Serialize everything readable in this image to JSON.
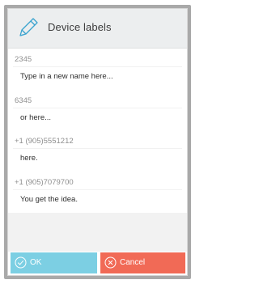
{
  "dialog": {
    "title": "Device labels",
    "title_icon": "pencil-icon"
  },
  "entries": [
    {
      "number": "2345",
      "label": "Type in a new name here..."
    },
    {
      "number": "6345",
      "label": "or here..."
    },
    {
      "number": "+1 (905)5551212",
      "label": "here."
    },
    {
      "number": "+1 (905)7079700",
      "label": "You get the idea."
    }
  ],
  "buttons": {
    "ok_label": "OK",
    "ok_icon": "check-circle-icon",
    "cancel_label": "Cancel",
    "cancel_icon": "x-circle-icon"
  },
  "colors": {
    "ok": "#7ccfe3",
    "cancel": "#f16a56",
    "header_bg": "#eceeef",
    "icon_accent": "#3aa3cf"
  }
}
